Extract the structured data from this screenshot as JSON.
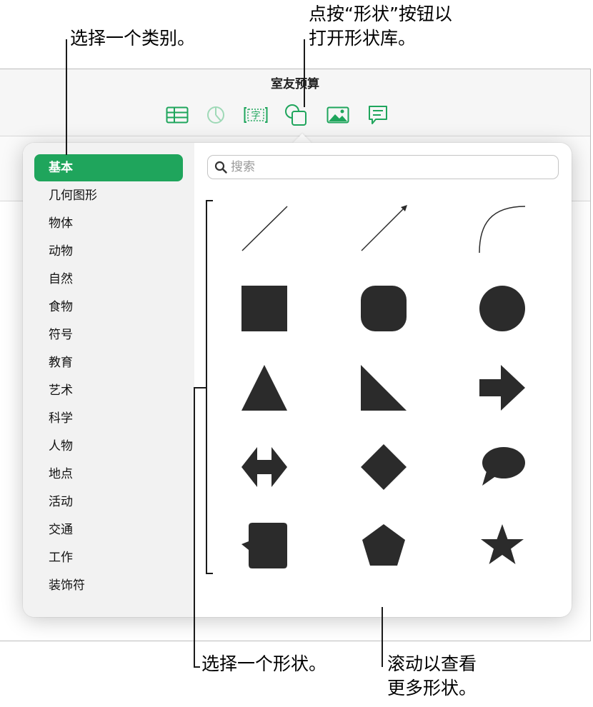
{
  "callouts": {
    "category": "选择一个类别。",
    "shape_button_line1": "点按“形状”按钮以",
    "shape_button_line2": "打开形状库。",
    "choose_shape": "选择一个形状。",
    "scroll_line1": "滚动以查看",
    "scroll_line2": "更多形状。"
  },
  "window": {
    "title": "室友预算"
  },
  "toolbar": {
    "tools": [
      "table-icon",
      "chart-icon",
      "text-box-icon",
      "shape-icon",
      "media-icon",
      "comment-icon"
    ],
    "accent": "#1fa55c"
  },
  "sidebar": {
    "items": [
      {
        "label": "基本",
        "selected": true
      },
      {
        "label": "几何图形"
      },
      {
        "label": "物体"
      },
      {
        "label": "动物"
      },
      {
        "label": "自然"
      },
      {
        "label": "食物"
      },
      {
        "label": "符号"
      },
      {
        "label": "教育"
      },
      {
        "label": "艺术"
      },
      {
        "label": "科学"
      },
      {
        "label": "人物"
      },
      {
        "label": "地点"
      },
      {
        "label": "活动"
      },
      {
        "label": "交通"
      },
      {
        "label": "工作"
      },
      {
        "label": "装饰符"
      }
    ]
  },
  "search": {
    "placeholder": "搜索",
    "value": ""
  },
  "shapes": [
    "line",
    "arrow-line",
    "curve",
    "square",
    "rounded-square",
    "circle",
    "triangle",
    "right-triangle",
    "arrow-right",
    "double-arrow",
    "diamond",
    "speech-bubble",
    "callout-box",
    "pentagon",
    "star"
  ],
  "colors": {
    "shape_fill": "#2b2b2b",
    "selected_category": "#1fa55c"
  }
}
